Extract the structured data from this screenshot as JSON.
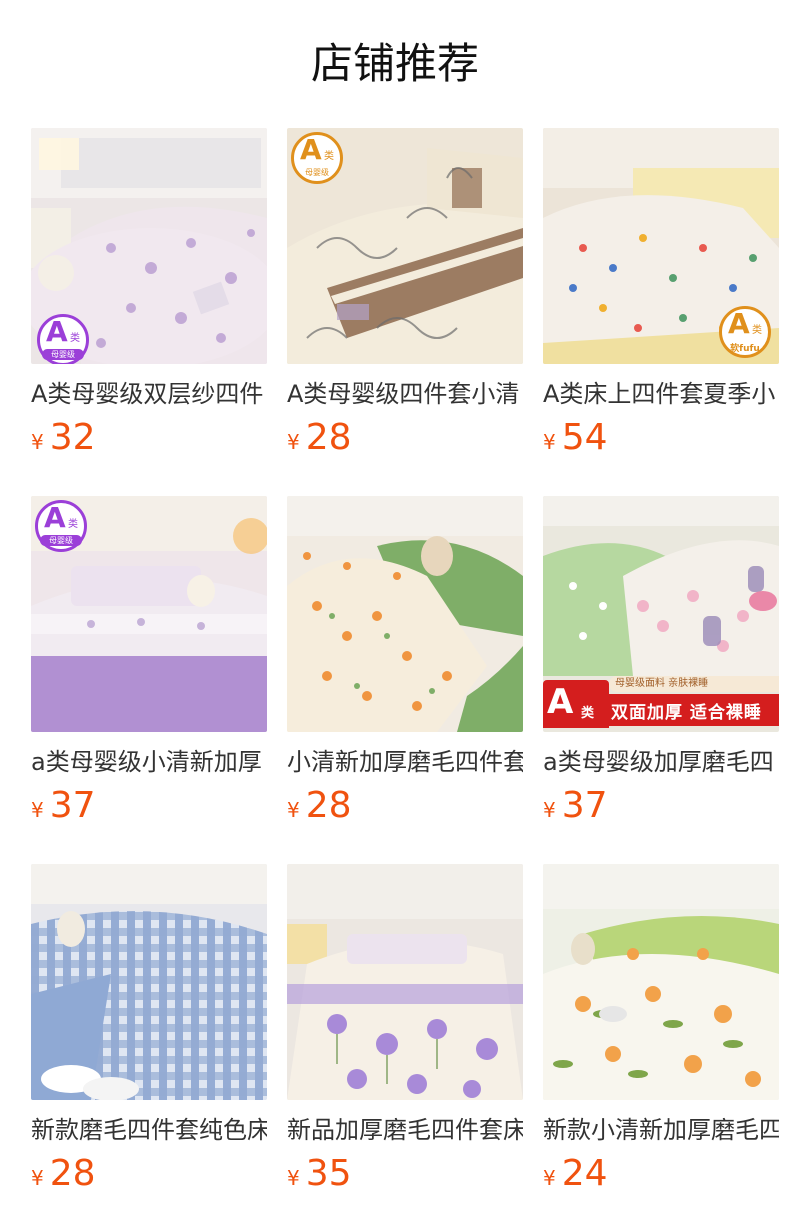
{
  "page": {
    "title": "店铺推荐"
  },
  "colors": {
    "price": "#f0520f",
    "badge_purple": "#9b3fd8",
    "badge_orange": "#e0901c",
    "badge_red": "#d41e1e"
  },
  "products": [
    {
      "name": "A类母婴级双层纱四件",
      "currency": "¥",
      "price": "32",
      "badge": {
        "main": "A",
        "sub": "类",
        "caption": "母婴级"
      }
    },
    {
      "name": "A类母婴级四件套小清",
      "currency": "¥",
      "price": "28",
      "badge": {
        "main": "A",
        "sub": "类",
        "caption": "母婴级"
      }
    },
    {
      "name": "A类床上四件套夏季小",
      "currency": "¥",
      "price": "54",
      "badge": {
        "main": "A",
        "sub": "类",
        "caption": "软fufu"
      }
    },
    {
      "name": "a类母婴级小清新加厚",
      "currency": "¥",
      "price": "37",
      "badge": {
        "main": "A",
        "sub": "类",
        "caption": "母婴级"
      }
    },
    {
      "name": "小清新加厚磨毛四件套",
      "currency": "¥",
      "price": "28"
    },
    {
      "name": "a类母婴级加厚磨毛四",
      "currency": "¥",
      "price": "37",
      "banner": {
        "main": "A",
        "sub": "类",
        "tag": "母婴级面料 亲肤裸睡",
        "text": "双面加厚 适合裸睡"
      }
    },
    {
      "name": "新款磨毛四件套纯色床",
      "currency": "¥",
      "price": "28"
    },
    {
      "name": "新品加厚磨毛四件套床",
      "currency": "¥",
      "price": "35"
    },
    {
      "name": "新款小清新加厚磨毛四",
      "currency": "¥",
      "price": "24"
    }
  ]
}
